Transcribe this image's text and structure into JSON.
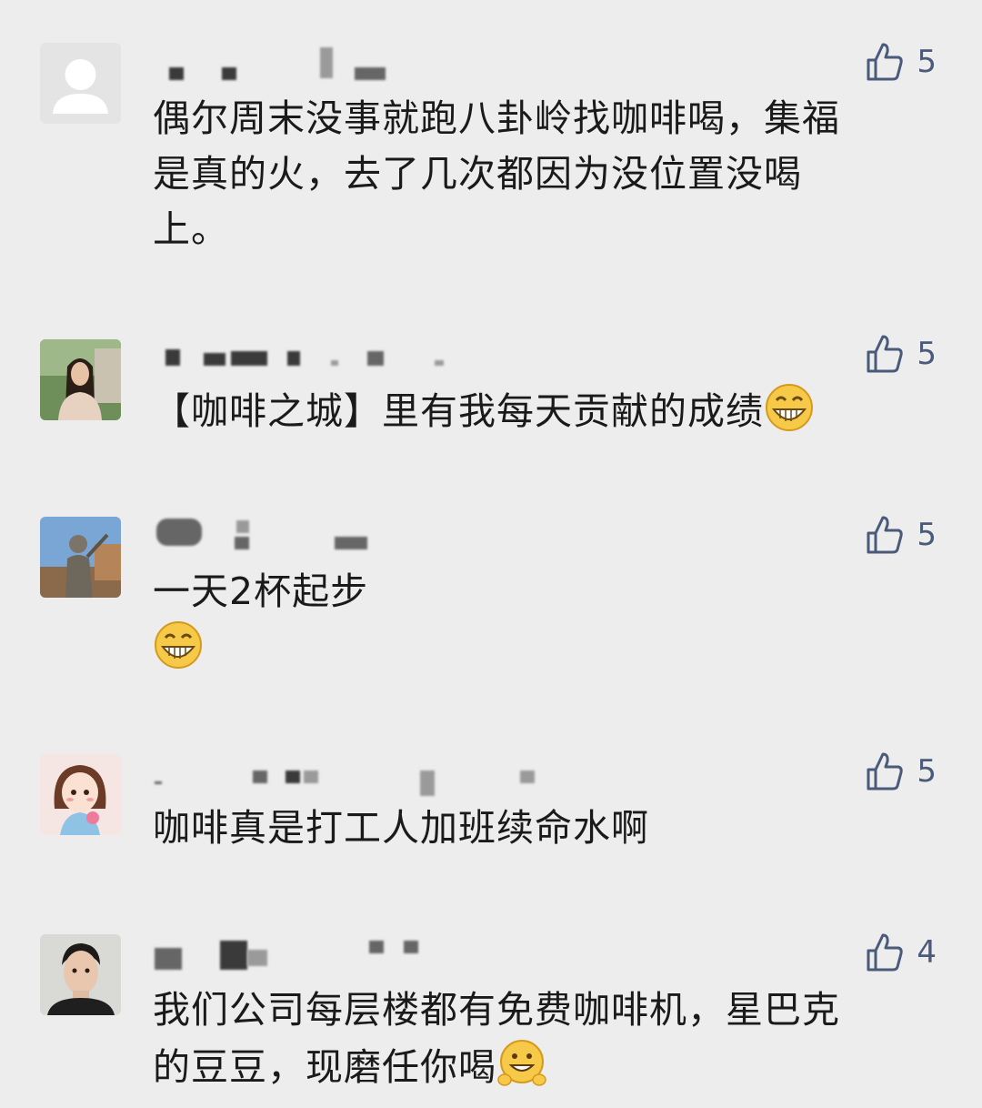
{
  "comments": [
    {
      "avatar": "default-avatar-icon",
      "likes": "5",
      "text_lines": [
        "偶尔周末没事就跑八卦岭找咖啡喝，集福",
        "是真的火，去了几次都因为没位置没喝",
        "上。"
      ]
    },
    {
      "avatar": "woman-photo-avatar",
      "likes": "5",
      "text": "【咖啡之城】里有我每天贡献的成绩",
      "emoji": "grin-emoji-icon"
    },
    {
      "avatar": "statue-photo-avatar",
      "likes": "5",
      "text": "一天2杯起步",
      "emoji": "grin-emoji-icon"
    },
    {
      "avatar": "cartoon-girl-avatar",
      "likes": "5",
      "text": "咖啡真是打工人加班续命水啊"
    },
    {
      "avatar": "man-photo-avatar",
      "likes": "4",
      "text_lines": [
        "我们公司每层楼都有免费咖啡机，星巴克",
        "的豆豆，现磨任你喝"
      ],
      "emoji": "happy-emoji-icon"
    }
  ]
}
